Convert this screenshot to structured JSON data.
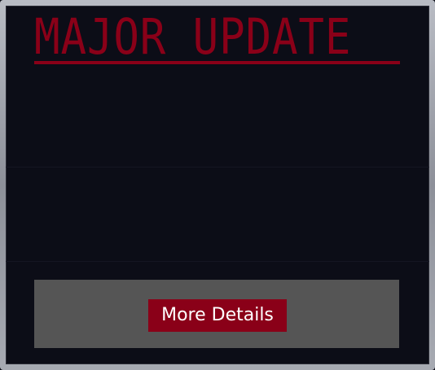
{
  "header": {
    "title": "MAJOR UPDATE"
  },
  "actions": {
    "more_details_label": "More Details"
  },
  "colors": {
    "accent": "#8a0018",
    "background": "#0c0d17",
    "panel": "#555555",
    "frame": "#a7aab2"
  }
}
